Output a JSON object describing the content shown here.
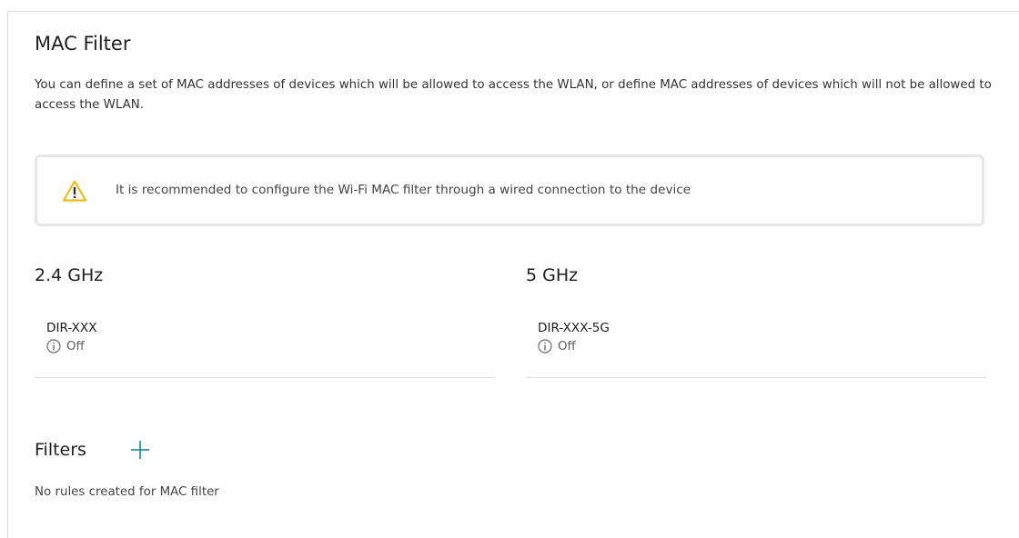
{
  "page": {
    "title": "MAC Filter",
    "description": "You can define a set of MAC addresses of devices which will be allowed to access the WLAN, or define MAC addresses of devices which will not be allowed to access the WLAN."
  },
  "warning": {
    "icon": "warning-triangle-icon",
    "text": "It is recommended to configure the Wi-Fi MAC filter through a wired connection to the device",
    "icon_color": "#f3b700"
  },
  "bands": [
    {
      "title": "2.4 GHz",
      "network": {
        "name": "DIR-XXX",
        "status": "Off",
        "status_icon": "info-icon"
      }
    },
    {
      "title": "5 GHz",
      "network": {
        "name": "DIR-XXX-5G",
        "status": "Off",
        "status_icon": "info-icon"
      }
    }
  ],
  "filters": {
    "title": "Filters",
    "add_icon": "plus-icon",
    "add_icon_color": "#1a8a8c",
    "empty_text": "No rules created for MAC filter"
  }
}
